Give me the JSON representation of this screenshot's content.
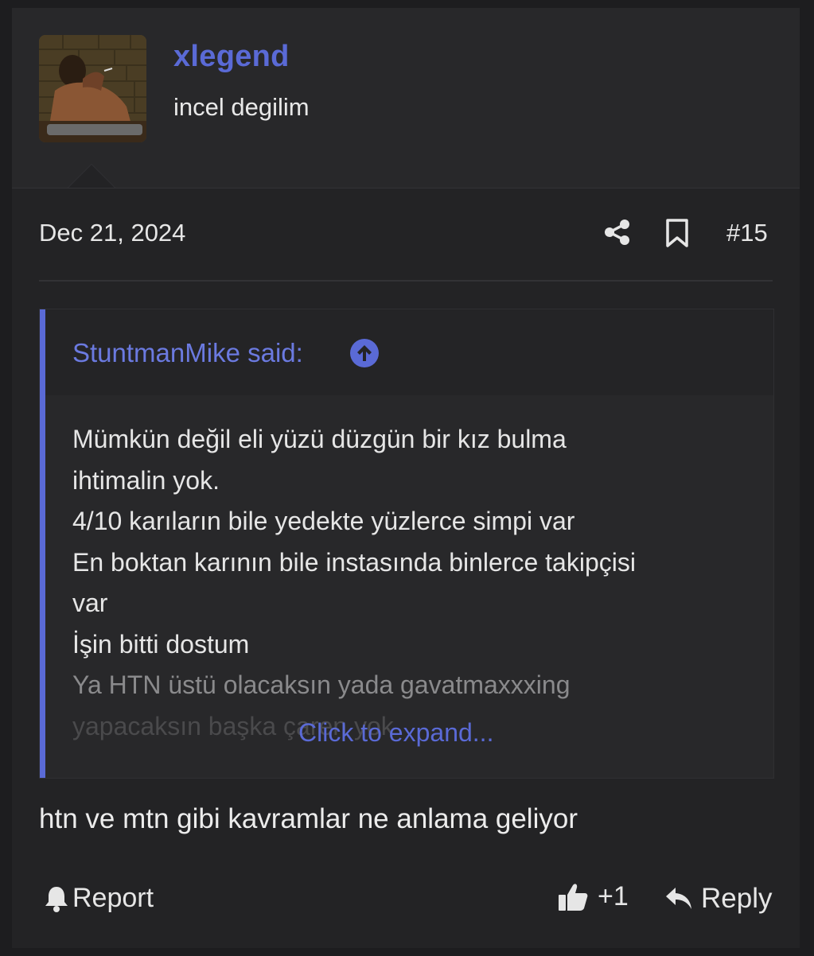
{
  "user": {
    "name": "xlegend",
    "title": "incel degilim"
  },
  "post": {
    "date": "Dec 21, 2024",
    "number": "#15",
    "quote": {
      "author_label": "StuntmanMike said:",
      "lines": [
        "Mümkün değil eli yüzü düzgün bir kız bulma",
        "ihtimalin yok.",
        "4/10 karıların bile yedekte yüzlerce simpi var",
        "En boktan karının bile instasında binlerce takipçisi",
        "var",
        "İşin bitti dostum",
        "Ya HTN üstü olacaksın yada gavatmaxxxing",
        "yapacaksın başka çaren yok"
      ],
      "expand_label": "Click to expand..."
    },
    "message": "htn ve mtn gibi kavramlar ne anlama geliyor"
  },
  "actions": {
    "report_label": "Report",
    "like_count": "+1",
    "reply_label": "Reply"
  },
  "colors": {
    "accent": "#5a6ad6",
    "background": "#1d1d1f",
    "panel": "#232325"
  },
  "icons": [
    "share-icon",
    "bookmark-icon",
    "arrow-up-circle-icon",
    "bell-icon",
    "thumbs-up-icon",
    "reply-icon"
  ]
}
